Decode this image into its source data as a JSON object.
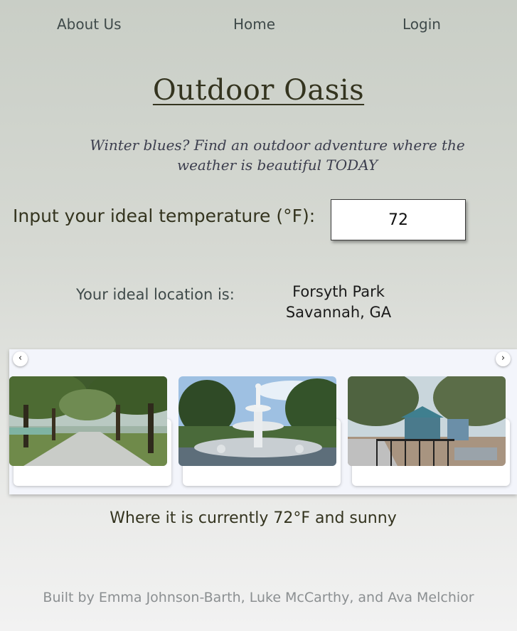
{
  "nav": {
    "about": "About Us",
    "home": "Home",
    "login": "Login"
  },
  "header": {
    "title": "Outdoor Oasis",
    "subtitle": "Winter blues? Find an outdoor adventure where the weather is beautiful TODAY"
  },
  "temperature": {
    "label": "Input your ideal temperature (°F):",
    "value": "72"
  },
  "location": {
    "label": "Your ideal location is:",
    "name": "Forsyth Park",
    "city": "Savannah, GA"
  },
  "carousel": {
    "prev_icon": "chevron-left-icon",
    "next_icon": "chevron-right-icon",
    "prev_glyph": "‹",
    "next_glyph": "›",
    "photos": [
      {
        "subject": "oak-lined-path-photo"
      },
      {
        "subject": "fountain-photo"
      },
      {
        "subject": "playground-photo"
      }
    ]
  },
  "weather": {
    "text": "Where it is currently 72°F and sunny"
  },
  "footer": {
    "credits": "Built by Emma Johnson-Barth, Luke McCarthy, and Ava Melchior"
  },
  "colors": {
    "title": "#34341f",
    "nav": "#3f4a4a",
    "carousel_bg": "#f3f5fb",
    "footer": "#8b8f91"
  }
}
